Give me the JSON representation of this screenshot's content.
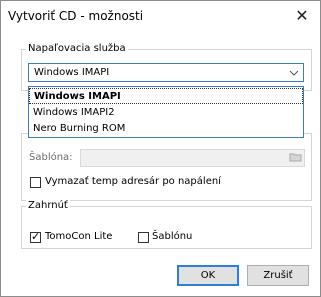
{
  "window": {
    "title": "Vytvoriť CD - možnosti",
    "close_glyph": "✕"
  },
  "burn_service": {
    "group_label": "Napaľovacia služba",
    "selected_value": "Windows IMAPI",
    "options": [
      "Windows IMAPI",
      "Windows IMAPI2",
      "Nero Burning ROM"
    ],
    "highlighted_index": 0
  },
  "template": {
    "label": "Šablóna:",
    "value": "",
    "browse_icon": "folder-browse-icon",
    "clear_temp_label": "Vymazať temp adresár po napálení",
    "clear_temp_checked": false
  },
  "include": {
    "group_label": "Zahrnúť",
    "tomocon_label": "TomoCon Lite",
    "tomocon_checked": true,
    "template_label": "Šablónu",
    "template_checked": false
  },
  "buttons": {
    "ok": "OK",
    "cancel": "Zrušiť"
  },
  "colors": {
    "focus_border": "#3c7fb1",
    "default_button_border": "#2f7fd6"
  }
}
